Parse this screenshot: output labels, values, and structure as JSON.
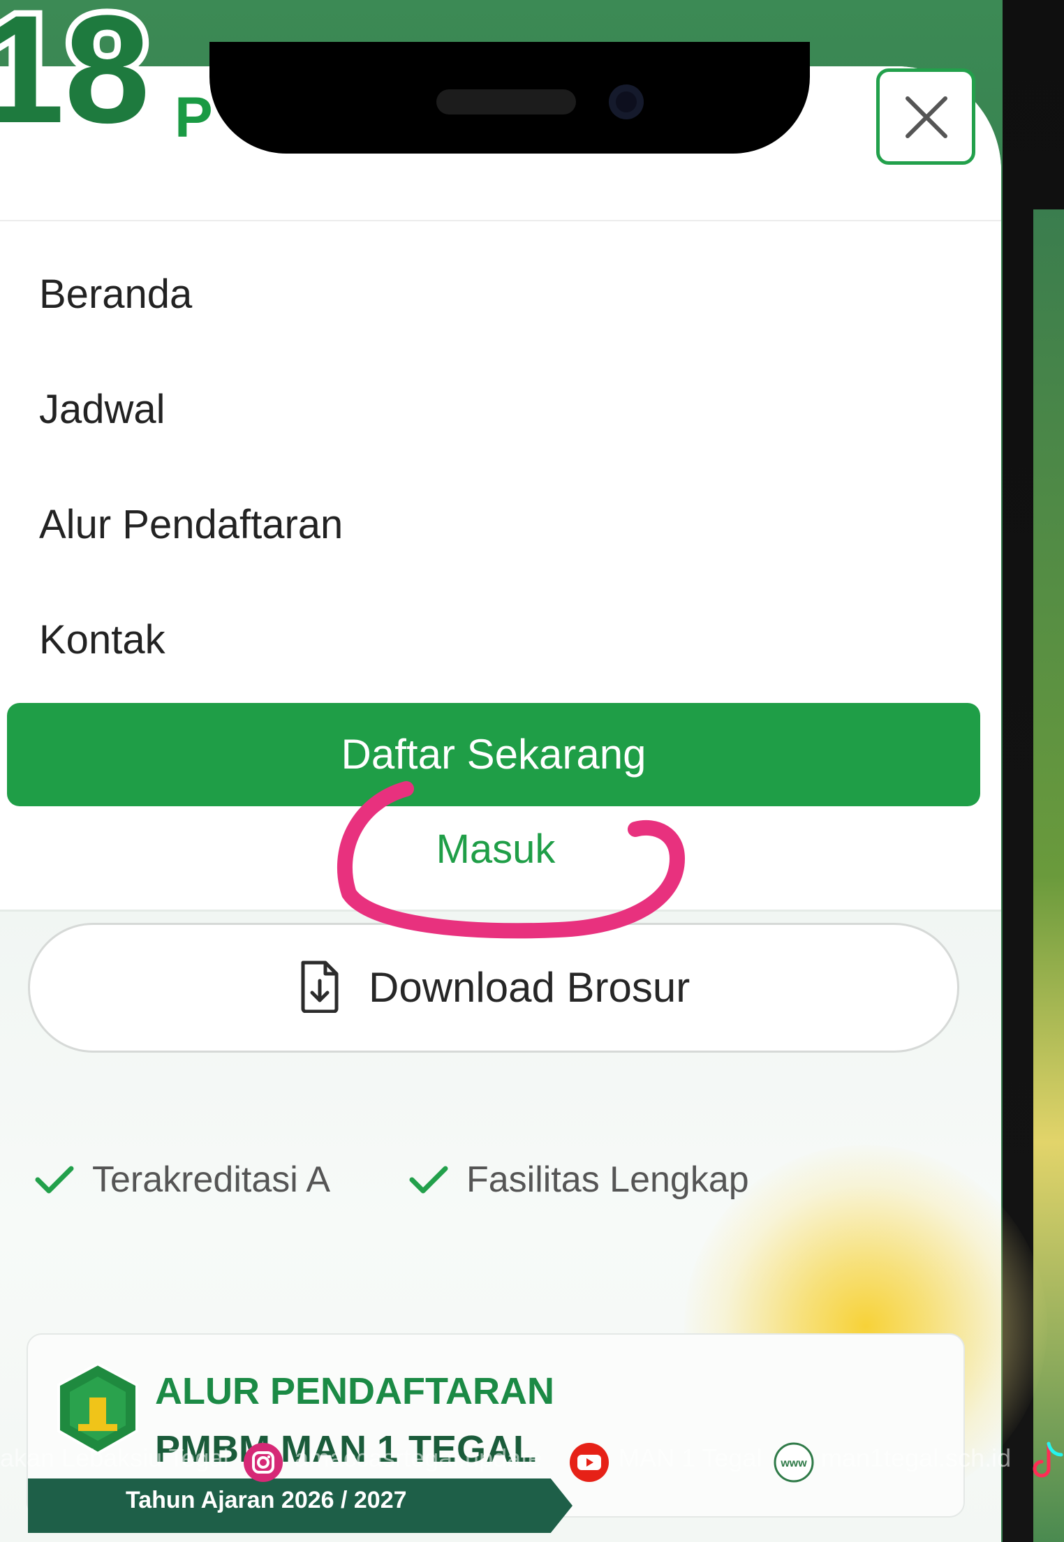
{
  "badge": {
    "number": "18"
  },
  "header": {
    "brand_partial": "P"
  },
  "menu": {
    "items": [
      "Beranda",
      "Jadwal",
      "Alur Pendaftaran",
      "Kontak"
    ],
    "register_label": "Daftar Sekarang",
    "login_label": "Masuk"
  },
  "hero": {
    "download_label": "Download Brosur",
    "features": [
      "Terakreditasi A",
      "Fasilitas Lengkap"
    ]
  },
  "card": {
    "title": "ALUR PENDAFTARAN",
    "subtitle": "PMBM MAN 1 TEGAL",
    "year": "Tahun Ajaran 2026 / 2027"
  },
  "watermark": {
    "left_text": "akan Lebaksiu Tegal",
    "instagram_text": "amaccasrtegal.update",
    "youtube_text": "MAN 1 Tegal",
    "website_text": "man1tegal.sch.id"
  },
  "colors": {
    "primary_green": "#1f9e47",
    "annotation_pink": "#e8317e",
    "frame_green": "#2f7a48"
  },
  "icons": [
    "close-icon",
    "document-download-icon",
    "check-icon",
    "instagram-icon",
    "youtube-icon",
    "web-icon",
    "tiktok-icon"
  ]
}
